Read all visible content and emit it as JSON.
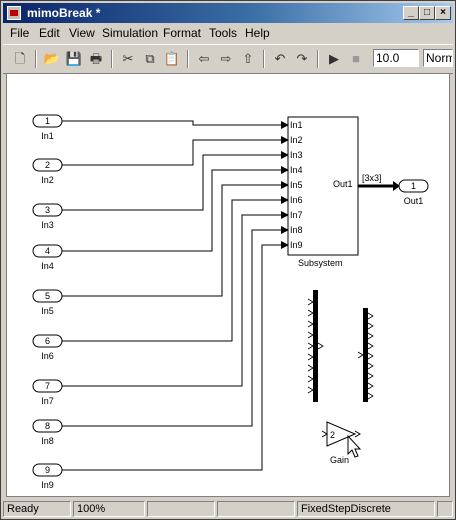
{
  "window": {
    "title": "mimoBreak *"
  },
  "menu": [
    "File",
    "Edit",
    "View",
    "Simulation",
    "Format",
    "Tools",
    "Help"
  ],
  "toolbar": {
    "stop_time": "10.0",
    "sim_mode": "Normal"
  },
  "inports": [
    {
      "num": "1",
      "label": "In1"
    },
    {
      "num": "2",
      "label": "In2"
    },
    {
      "num": "3",
      "label": "In3"
    },
    {
      "num": "4",
      "label": "In4"
    },
    {
      "num": "5",
      "label": "In5"
    },
    {
      "num": "6",
      "label": "In6"
    },
    {
      "num": "7",
      "label": "In7"
    },
    {
      "num": "8",
      "label": "In8"
    },
    {
      "num": "9",
      "label": "In9"
    }
  ],
  "subsystem": {
    "name": "Subsystem",
    "inputs": [
      "In1",
      "In2",
      "In3",
      "In4",
      "In5",
      "In6",
      "In7",
      "In8",
      "In9"
    ],
    "output": "Out1"
  },
  "signal": {
    "dimension": "[3x3]"
  },
  "outport": {
    "num": "1",
    "label": "Out1"
  },
  "gain": {
    "value": "2",
    "label": "Gain"
  },
  "status": {
    "state": "Ready",
    "zoom": "100%",
    "solver": "FixedStepDiscrete"
  },
  "colors": {
    "title_start": "#0a246a",
    "title_end": "#a6caf0",
    "canvas": "#ffffff",
    "chrome": "#d4d0c8"
  }
}
